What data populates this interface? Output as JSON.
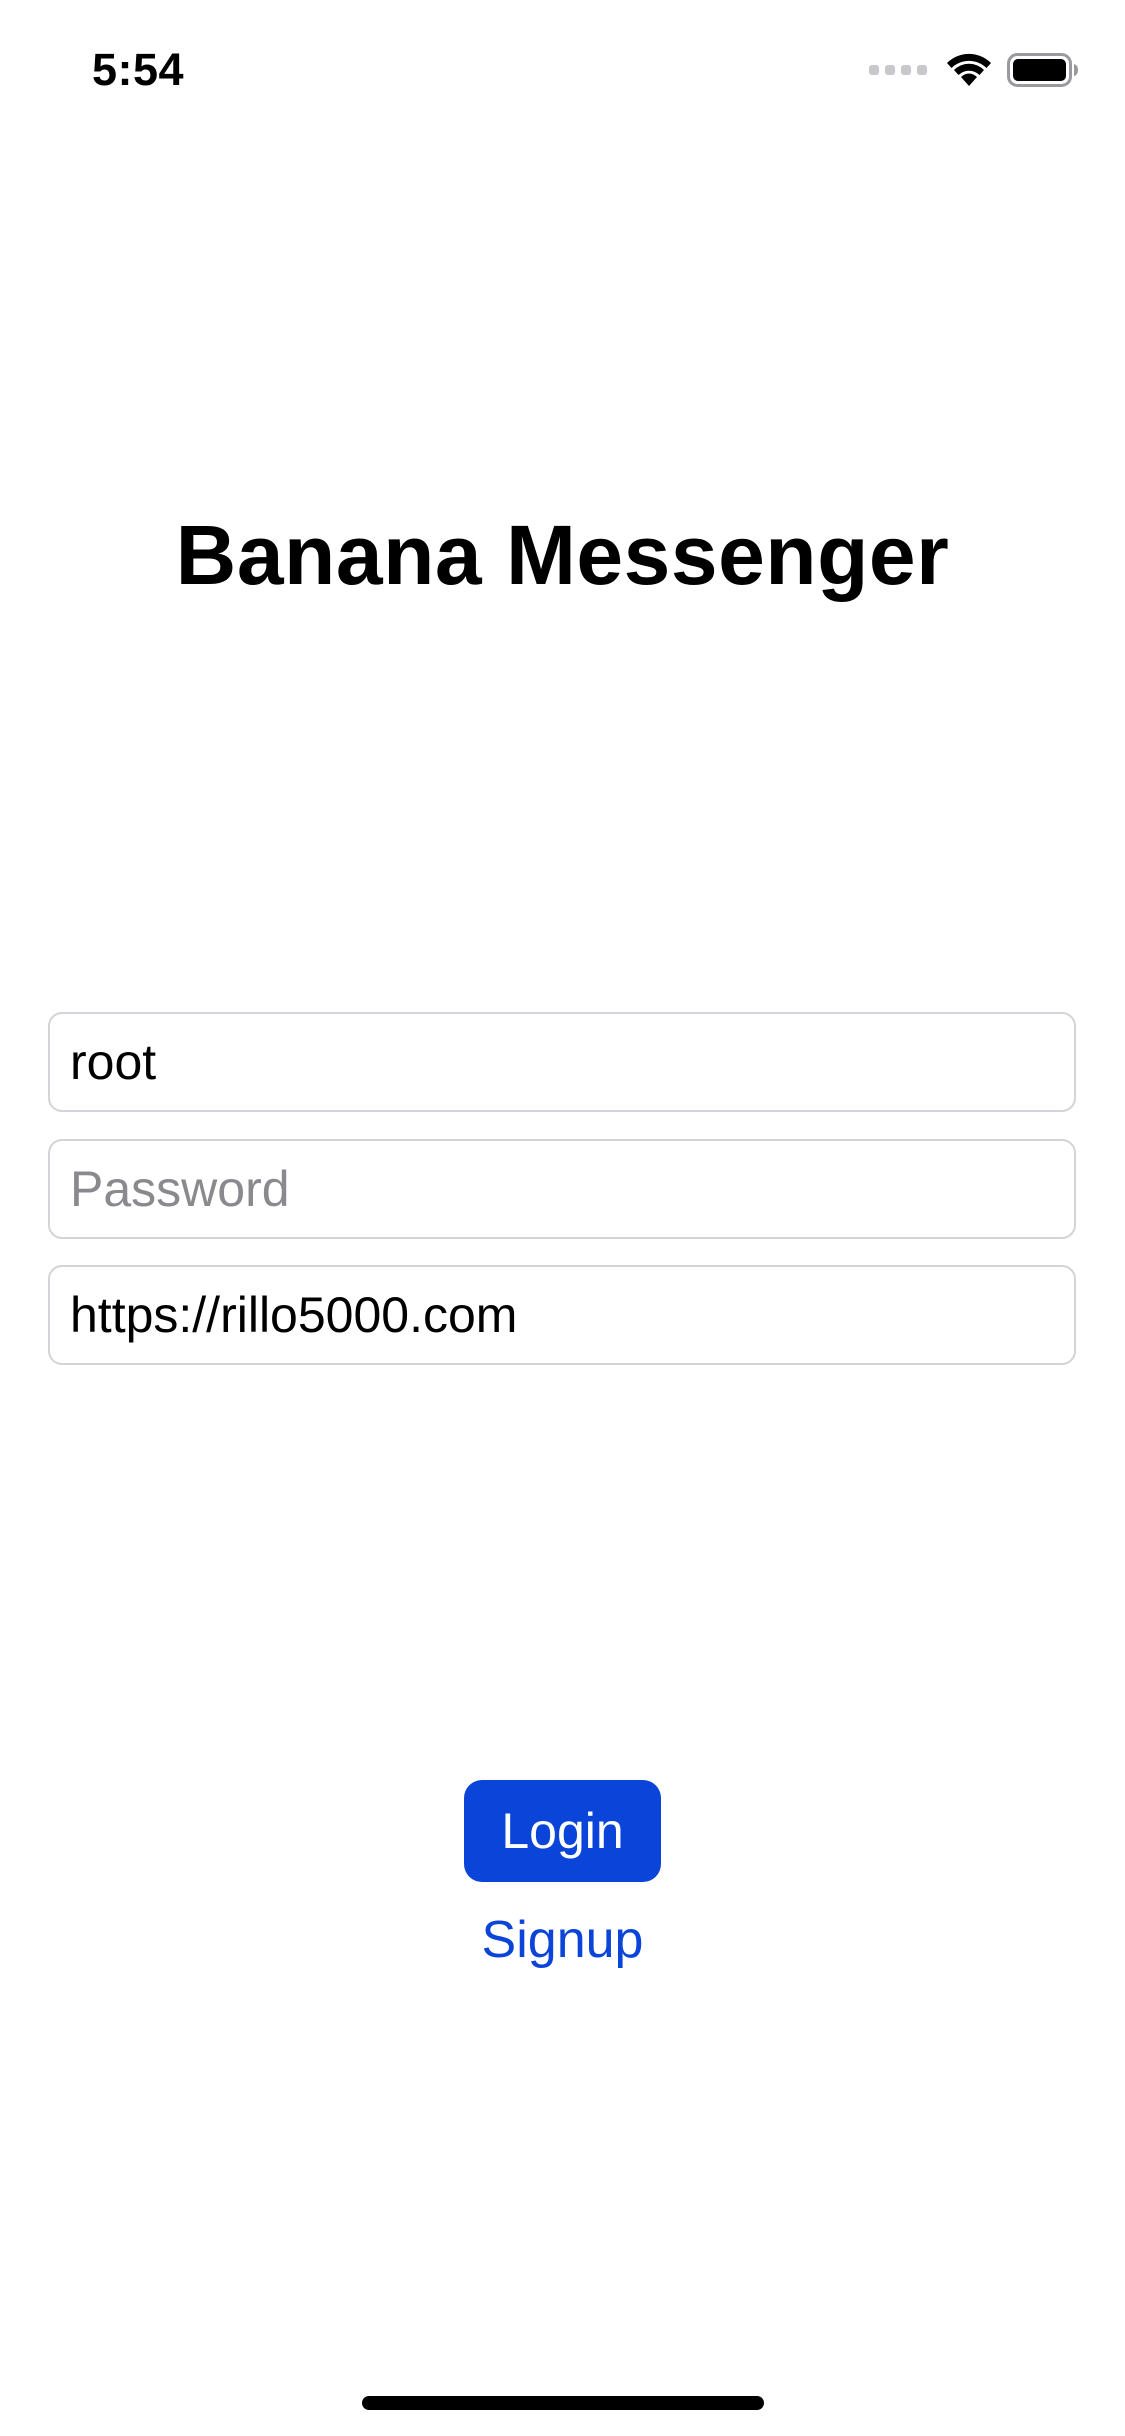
{
  "status_bar": {
    "time": "5:54",
    "icons": [
      "cellular-signal-icon",
      "wifi-icon",
      "battery-icon"
    ]
  },
  "app": {
    "title": "Banana Messenger"
  },
  "form": {
    "username": {
      "value": "root",
      "placeholder": ""
    },
    "password": {
      "value": "",
      "placeholder": "Password"
    },
    "server": {
      "value": "https://rillo5000.com",
      "placeholder": ""
    }
  },
  "actions": {
    "login_label": "Login",
    "signup_label": "Signup"
  },
  "colors": {
    "accent": "#0a44d9",
    "field_border": "#d4d4d8",
    "placeholder": "#8a8a8e",
    "background": "#ffffff"
  }
}
